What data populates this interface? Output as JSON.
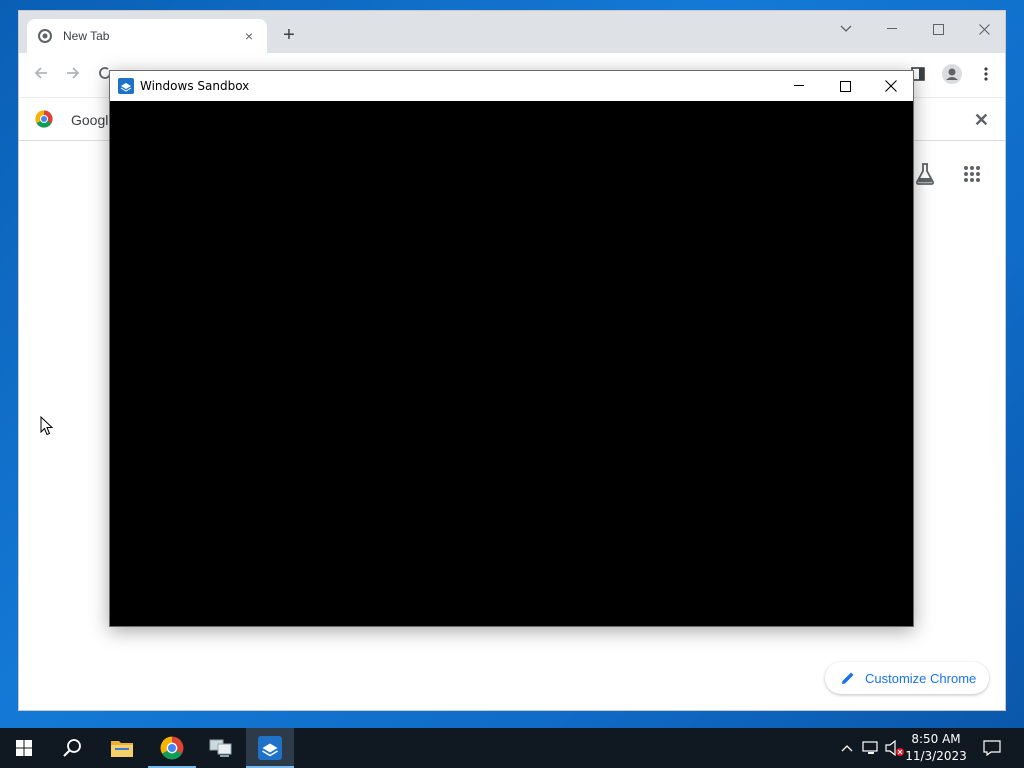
{
  "chrome": {
    "tab_title": "New Tab",
    "tab_close": "×",
    "new_tab": "+",
    "infobar_text": "Google",
    "infobar_close": "✕",
    "customize_label": "Customize Chrome",
    "accent_color": "#1a73e8"
  },
  "sandbox": {
    "title": "Windows Sandbox",
    "icon": "windows-sandbox-icon"
  },
  "taskbar": {
    "time": "8:50 AM",
    "date": "11/3/2023",
    "pinned": [
      "start",
      "search",
      "file-explorer",
      "chrome",
      "network-app",
      "windows-sandbox"
    ]
  }
}
